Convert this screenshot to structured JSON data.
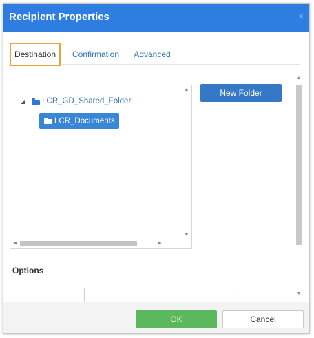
{
  "dialog": {
    "title": "Recipient Properties",
    "close_glyph": "×"
  },
  "tabs": [
    {
      "label": "Destination",
      "active": true
    },
    {
      "label": "Confirmation",
      "active": false
    },
    {
      "label": "Advanced",
      "active": false
    }
  ],
  "tree": {
    "nodes": [
      {
        "label": "LCR_GD_Shared_Folder",
        "icon": "folder-icon",
        "expanded": true,
        "selected": false
      },
      {
        "label": "LCR_Documents",
        "icon": "folder-icon",
        "selected": true
      }
    ]
  },
  "actions": {
    "new_folder_label": "New Folder"
  },
  "options": {
    "section_label": "Options"
  },
  "footer": {
    "ok_label": "OK",
    "cancel_label": "Cancel"
  },
  "colors": {
    "title_bar": "#2e7de0",
    "accent_blue": "#3578c6",
    "ok_green": "#5cb85c",
    "tab_highlight": "#e8a33c"
  }
}
